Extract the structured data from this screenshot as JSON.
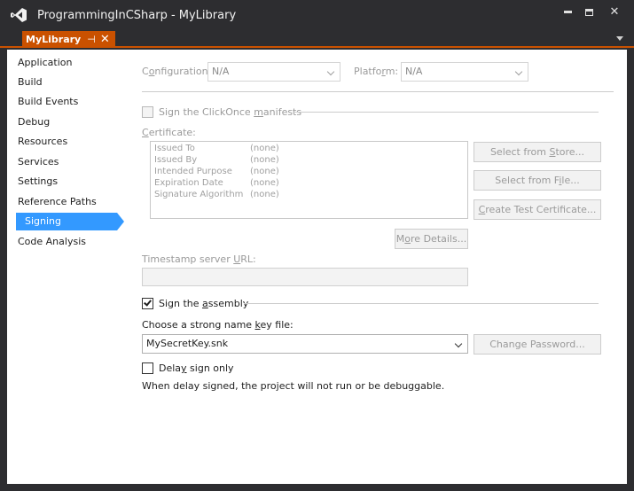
{
  "window": {
    "title": "ProgrammingInCSharp - MyLibrary",
    "minimize_label": "minimize",
    "maximize_label": "maximize",
    "close_glyph": "✕"
  },
  "tab": {
    "label": "MyLibrary",
    "pin_glyph": "⊣",
    "close_glyph": "✕"
  },
  "nav": {
    "items": [
      {
        "label": "Application"
      },
      {
        "label": "Build"
      },
      {
        "label": "Build Events"
      },
      {
        "label": "Debug"
      },
      {
        "label": "Resources"
      },
      {
        "label": "Services"
      },
      {
        "label": "Settings"
      },
      {
        "label": "Reference Paths"
      },
      {
        "label": "Signing",
        "active": true
      },
      {
        "label": "Code Analysis"
      }
    ]
  },
  "config": {
    "configuration_label_pre": "C",
    "configuration_label_u": "o",
    "configuration_label_post": "nfiguration:",
    "configuration_value": "N/A",
    "platform_label_pre": "Platfo",
    "platform_label_u": "r",
    "platform_label_post": "m:",
    "platform_value": "N/A"
  },
  "clickonce": {
    "label_pre": "Sign the ClickOnce ",
    "label_u": "m",
    "label_post": "anifests",
    "checked": false,
    "certificate_label_u": "C",
    "certificate_label_post": "ertificate:",
    "certificate_fields": [
      {
        "name": "Issued To",
        "value": "(none)"
      },
      {
        "name": "Issued By",
        "value": "(none)"
      },
      {
        "name": "Intended Purpose",
        "value": "(none)"
      },
      {
        "name": "Expiration Date",
        "value": "(none)"
      },
      {
        "name": "Signature Algorithm",
        "value": "(none)"
      }
    ],
    "select_store_pre": "Select from ",
    "select_store_u": "S",
    "select_store_post": "tore...",
    "select_file_pre": "Select from F",
    "select_file_u": "i",
    "select_file_post": "le...",
    "create_test_u": "C",
    "create_test_post": "reate Test Certificate...",
    "more_details_pre": "M",
    "more_details_u": "o",
    "more_details_post": "re Details...",
    "timestamp_label_pre": "Timestamp server ",
    "timestamp_label_u": "U",
    "timestamp_label_post": "RL:",
    "timestamp_value": ""
  },
  "assembly": {
    "sign_label_pre": "Sign the ",
    "sign_label_u": "a",
    "sign_label_post": "ssembly",
    "checked": true,
    "key_file_label_pre": "Choose a strong name ",
    "key_file_label_u": "k",
    "key_file_label_post": "ey file:",
    "key_file_value": "MySecretKey.snk",
    "change_password": "Change Password...",
    "delay_sign_pre": "Dela",
    "delay_sign_u": "y",
    "delay_sign_post": " sign only",
    "delay_checked": false,
    "delay_note": "When delay signed, the project will not run or be debuggable."
  },
  "colors": {
    "accent": "#ca5100",
    "selection": "#3399ff",
    "chrome": "#2d2d30"
  },
  "icons": {
    "app": "visual-studio-logo-icon",
    "dropdown": "chevron-down-icon",
    "check": "checkmark-icon"
  }
}
